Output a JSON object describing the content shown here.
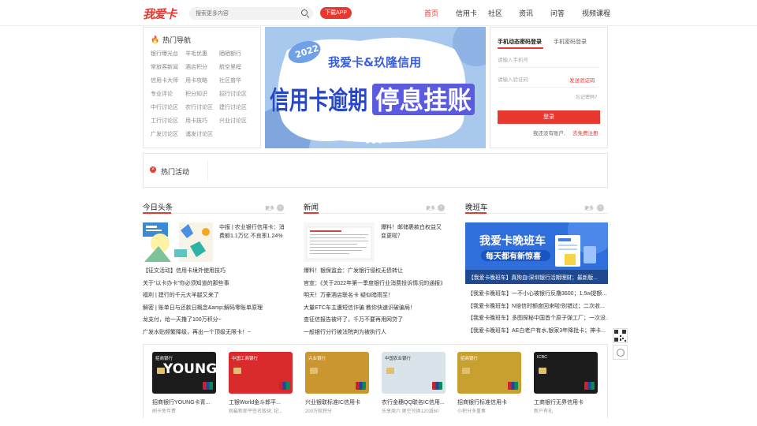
{
  "header": {
    "logo": "我爱卡",
    "search_placeholder": "搜索更多内容",
    "download_btn": "下载APP",
    "nav": [
      "首页",
      "信用卡",
      "社区",
      "资讯",
      "问答",
      "视频课程"
    ]
  },
  "hot_nav": {
    "title": "热门导航",
    "rows": [
      [
        "银行曝光台",
        "羊毛优惠",
        "晒晒额行"
      ],
      [
        "常旅客新闻",
        "酒店积分",
        "航空里程"
      ],
      [
        "信用卡大师",
        "用卡攻略",
        "社区普华"
      ],
      [
        "专业评论",
        "积分知识",
        "招行讨论区"
      ],
      [
        "中行讨论区",
        "农行讨论区",
        "建行讨论区"
      ],
      [
        "工行讨论区",
        "用卡技巧",
        "兴业讨论区"
      ],
      [
        "广发讨论区",
        "浦发讨论区",
        ""
      ]
    ]
  },
  "banner": {
    "badge": "2022",
    "line1": "我爱卡&玖隆信用",
    "line2": "信用卡逾期",
    "line3": "停息挂账"
  },
  "login": {
    "tab_sms": "手机动态密码登录",
    "tab_pwd": "手机密码登录",
    "phone_placeholder": "请输入手机号",
    "code_placeholder": "请输入验证码",
    "send_code": "发送验证码",
    "forgot": "忘记密码?",
    "login_btn": "登录",
    "no_account": "我还没有账户,",
    "register": "去免费注册"
  },
  "hot_activity": {
    "title": "热门活动"
  },
  "today": {
    "title": "今日头条",
    "more": "更多",
    "feature_text": "中报 | 农业银行信用卡：消费额1.1万亿 不良率1.24%",
    "items": [
      "【征文活动】信用卡境外使用技巧",
      "关于“以卡办卡”你必须知道的那些事",
      "福利 | 建行的千元大羊腿又来了",
      "解密 | 账单日与还款日概念&amp;解码零账单原理",
      "龙支付，给一天撸了100万积分~",
      "广发水贴频繁降级，再出一个顶级无限卡！~"
    ]
  },
  "news": {
    "title": "新闻",
    "more": "更多",
    "feature_text": "爆料！邮储裹款白权益又变更啦？",
    "items": [
      "爆料！银保监会：广发银行侵权无债转让",
      "官宣：《关于2022年第一季度银行业消费投诉情况的通报》",
      "明天！万豪酒店联名卡 疑似暗雨至！",
      "大量ETC车主遭短信诈骗 教你快速识破骗局！",
      "查征信报告被坏了，千万不要再用网贷了",
      "一般银行分行被法院判为被执行人"
    ]
  },
  "evening": {
    "title": "晚班车",
    "more": "更多",
    "banner_l1": "我爱卡晚班车",
    "banner_l2": "每天都有新惊喜",
    "banner_cap": "【我爱卡晚班车】真狗血!深圳银行活期理财；最新版...",
    "items": [
      "【我爱卡晚班车】一不小心被银行反撸3600；1.5w提额...",
      "【我爱卡晚班车】N倍信时额度回来啦!别错过；二次收...",
      "【我爱卡晚班车】多图探秘中国首个原子弹工厂；一次没...",
      "【我爱卡晚班车】AE白老户有水,银家3年降批卡；神卡..."
    ]
  },
  "cards": [
    {
      "title": "招商银行YOUNG卡青...",
      "sub": "刷卡免年费",
      "face": "YOUNG",
      "bank": "招商银行",
      "bg": "#1b1b1b",
      "fg": "#ffffff"
    },
    {
      "title": "工银World金斗郎平...",
      "sub": "观最新郎平签名版球, 纪...",
      "face": "",
      "bank": "中国工商银行",
      "bg": "#d92b2b",
      "fg": "#ffffff"
    },
    {
      "title": "兴业银联标准IC信用卡",
      "sub": "200万航积分",
      "face": "",
      "bank": "兴业银行",
      "bg": "#c9962f",
      "fg": "#ffffff"
    },
    {
      "title": "农行金穗QQ联名IC信用...",
      "sub": "乐享周六 尾空兑换120减60",
      "face": "",
      "bank": "中国农业银行",
      "bg": "#d9e3ea",
      "fg": "#333333"
    },
    {
      "title": "招商银行标准信用卡",
      "sub": "小积分多重奏",
      "face": "",
      "bank": "招商银行",
      "bg": "#c8a030",
      "fg": "#ffffff"
    },
    {
      "title": "工商银行无界信用卡",
      "sub": "新户有礼",
      "face": "",
      "bank": "ICBC",
      "bg": "#1c1c1c",
      "fg": "#ffffff"
    }
  ]
}
